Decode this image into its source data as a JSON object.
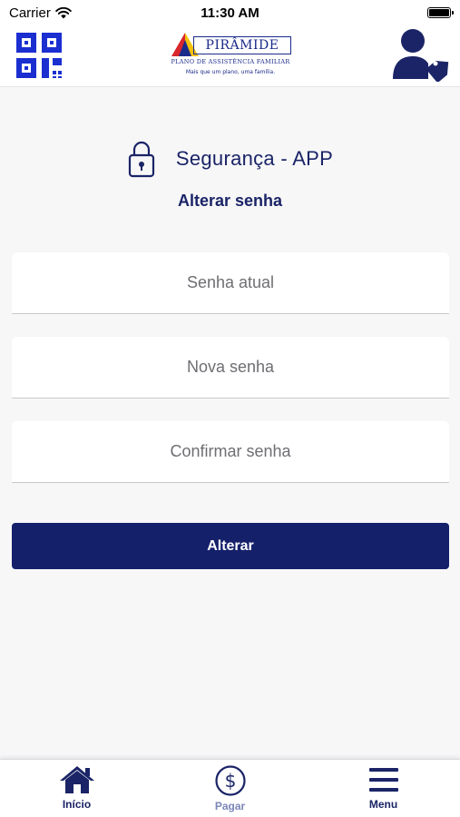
{
  "status_bar": {
    "carrier": "Carrier",
    "time": "11:30 AM"
  },
  "header": {
    "logo": {
      "name": "PIRÂMIDE",
      "subtitle": "PLANO DE ASSISTÊNCIA FAMILIAR",
      "tagline": "Mais que um plano, uma família."
    },
    "qr_icon": "qr-code-icon",
    "profile_icon": "user-tag-icon"
  },
  "section": {
    "title": "Segurança - APP",
    "icon": "lock-icon",
    "subtitle": "Alterar senha"
  },
  "form": {
    "current_password_placeholder": "Senha atual",
    "new_password_placeholder": "Nova senha",
    "confirm_password_placeholder": "Confirmar senha",
    "submit_label": "Alterar"
  },
  "tabbar": {
    "items": [
      {
        "label": "Início",
        "icon": "home-icon"
      },
      {
        "label": "Pagar",
        "icon": "dollar-circle-icon"
      },
      {
        "label": "Menu",
        "icon": "hamburger-menu-icon"
      }
    ]
  },
  "colors": {
    "primary": "#15206b",
    "title_text": "#1a2466",
    "tab_inactive": "#7b86b8",
    "background": "#f7f7f8",
    "brand_blue": "#1a2a8a",
    "brand_red": "#d8262c",
    "brand_yellow": "#f4c20d"
  }
}
